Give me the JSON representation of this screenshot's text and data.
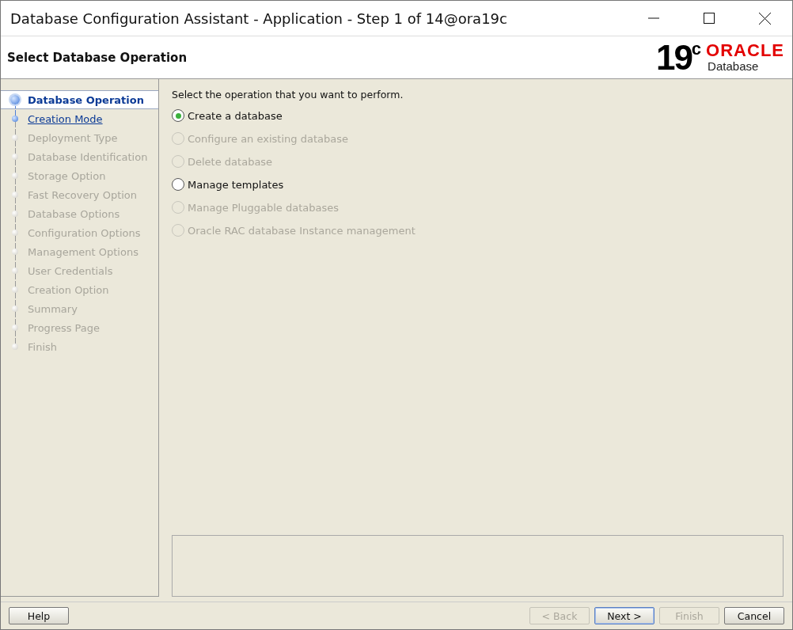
{
  "window": {
    "title": "Database Configuration Assistant - Application - Step 1 of 14@ora19c"
  },
  "header": {
    "title": "Select Database Operation",
    "logo": {
      "version": "19",
      "superscript": "c",
      "brand": "ORACLE",
      "product": "Database"
    }
  },
  "steps": [
    {
      "label": "Database Operation",
      "selected": true,
      "disabled": false
    },
    {
      "label": "Creation Mode",
      "selected": false,
      "disabled": false
    },
    {
      "label": "Deployment Type",
      "selected": false,
      "disabled": true
    },
    {
      "label": "Database Identification",
      "selected": false,
      "disabled": true
    },
    {
      "label": "Storage Option",
      "selected": false,
      "disabled": true
    },
    {
      "label": "Fast Recovery Option",
      "selected": false,
      "disabled": true
    },
    {
      "label": "Database Options",
      "selected": false,
      "disabled": true
    },
    {
      "label": "Configuration Options",
      "selected": false,
      "disabled": true
    },
    {
      "label": "Management Options",
      "selected": false,
      "disabled": true
    },
    {
      "label": "User Credentials",
      "selected": false,
      "disabled": true
    },
    {
      "label": "Creation Option",
      "selected": false,
      "disabled": true
    },
    {
      "label": "Summary",
      "selected": false,
      "disabled": true
    },
    {
      "label": "Progress Page",
      "selected": false,
      "disabled": true
    },
    {
      "label": "Finish",
      "selected": false,
      "disabled": true
    }
  ],
  "prompt": "Select the operation that you want to perform.",
  "options": [
    {
      "label": "Create a database",
      "selected": true,
      "disabled": false
    },
    {
      "label": "Configure an existing database",
      "selected": false,
      "disabled": true
    },
    {
      "label": "Delete database",
      "selected": false,
      "disabled": true
    },
    {
      "label": "Manage templates",
      "selected": false,
      "disabled": false
    },
    {
      "label": "Manage Pluggable databases",
      "selected": false,
      "disabled": true
    },
    {
      "label": "Oracle RAC database Instance management",
      "selected": false,
      "disabled": true
    }
  ],
  "buttons_left": [
    {
      "label": "Help",
      "disabled": false,
      "focused": false
    }
  ],
  "buttons_right": [
    {
      "label": "< Back",
      "disabled": true,
      "focused": false
    },
    {
      "label": "Next >",
      "disabled": false,
      "focused": true
    },
    {
      "label": "Finish",
      "disabled": true,
      "focused": false
    },
    {
      "label": "Cancel",
      "disabled": false,
      "focused": false
    }
  ]
}
